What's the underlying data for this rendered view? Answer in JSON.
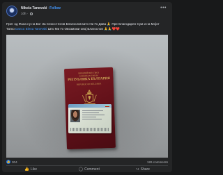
{
  "post": {
    "author": "Nikola Tanevski",
    "follow_label": "Follow",
    "time": "10h",
    "text_before_mention": "Прег од Фана ну на Бог За Сексо Ногов Благослов Што Ни Го Дава 🙏 Пре Благодарен Сум и на Мојот Татко ",
    "mention": "Danco Elena Tanevski",
    "text_after_mention": " Што Ми Го Овозможи овој Благослов 🙏🙏❤️❤️"
  },
  "photo": {
    "passport_line1": "ЕВРОПЕЙСКИ СЪЮЗ",
    "passport_line2": "EUROPEAN UNION",
    "passport_title": "РЕПУБЛИКА БЪЛГАРИЯ",
    "passport_subtitle": "REPUBLIC OF BULGARIA"
  },
  "stats": {
    "reactions": "304",
    "comments": "126 comments"
  },
  "actions": {
    "like": "Like",
    "comment": "Comment",
    "share": "Share"
  },
  "colors": {
    "background": "#18191a",
    "card": "#242526",
    "link": "#4599ff",
    "passport": "#6b141c"
  }
}
